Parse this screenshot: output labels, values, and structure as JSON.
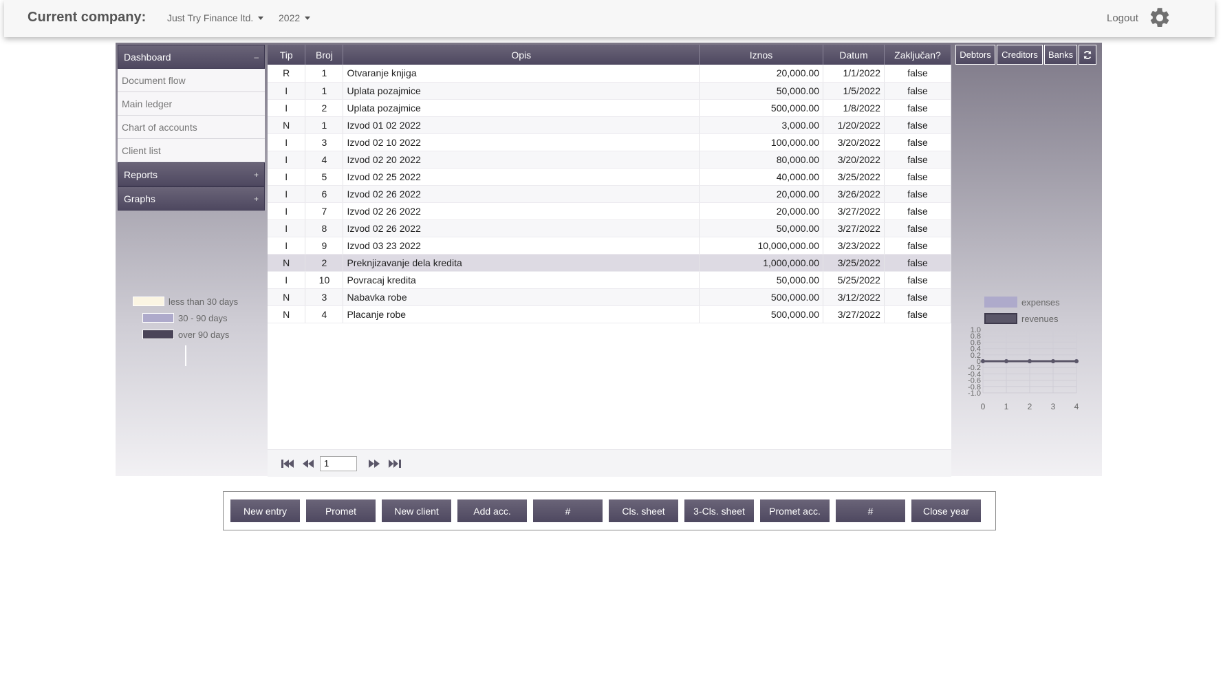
{
  "header": {
    "company_label": "Current company:",
    "company_value": "Just Try Finance ltd.",
    "year_value": "2022",
    "logout_label": "Logout"
  },
  "sidebar": {
    "dashboard": {
      "label": "Dashboard",
      "sign": "–"
    },
    "items": [
      {
        "label": "Document flow"
      },
      {
        "label": "Main ledger"
      },
      {
        "label": "Chart of accounts"
      },
      {
        "label": "Client list"
      }
    ],
    "reports": {
      "label": "Reports",
      "sign": "+"
    },
    "graphs": {
      "label": "Graphs",
      "sign": "+"
    }
  },
  "aging_legend": [
    {
      "label": "less than 30 days",
      "color": "#fbf5e3"
    },
    {
      "label": "30 - 90 days",
      "color": "#aeaacb"
    },
    {
      "label": "over 90 days",
      "color": "#4a4458"
    }
  ],
  "table": {
    "columns": [
      "Tip",
      "Broj",
      "Opis",
      "Iznos",
      "Datum",
      "Zaključan?"
    ],
    "rows": [
      {
        "tip": "R",
        "broj": "1",
        "opis": "Otvaranje knjiga",
        "iznos": "20,000.00",
        "datum": "1/1/2022",
        "locked": "false"
      },
      {
        "tip": "I",
        "broj": "1",
        "opis": "Uplata pozajmice",
        "iznos": "50,000.00",
        "datum": "1/5/2022",
        "locked": "false"
      },
      {
        "tip": "I",
        "broj": "2",
        "opis": "Uplata pozajmice",
        "iznos": "500,000.00",
        "datum": "1/8/2022",
        "locked": "false"
      },
      {
        "tip": "N",
        "broj": "1",
        "opis": "Izvod 01 02 2022",
        "iznos": "3,000.00",
        "datum": "1/20/2022",
        "locked": "false"
      },
      {
        "tip": "I",
        "broj": "3",
        "opis": "Izvod 02 10 2022",
        "iznos": "100,000.00",
        "datum": "3/20/2022",
        "locked": "false"
      },
      {
        "tip": "I",
        "broj": "4",
        "opis": "Izvod 02 20 2022",
        "iznos": "80,000.00",
        "datum": "3/20/2022",
        "locked": "false"
      },
      {
        "tip": "I",
        "broj": "5",
        "opis": "Izvod 02 25 2022",
        "iznos": "40,000.00",
        "datum": "3/25/2022",
        "locked": "false"
      },
      {
        "tip": "I",
        "broj": "6",
        "opis": "Izvod 02 26 2022",
        "iznos": "20,000.00",
        "datum": "3/26/2022",
        "locked": "false"
      },
      {
        "tip": "I",
        "broj": "7",
        "opis": "Izvod 02 26 2022",
        "iznos": "20,000.00",
        "datum": "3/27/2022",
        "locked": "false"
      },
      {
        "tip": "I",
        "broj": "8",
        "opis": "Izvod 02 26 2022",
        "iznos": "50,000.00",
        "datum": "3/27/2022",
        "locked": "false"
      },
      {
        "tip": "I",
        "broj": "9",
        "opis": "Izvod 03 23 2022",
        "iznos": "10,000,000.00",
        "datum": "3/23/2022",
        "locked": "false"
      },
      {
        "tip": "N",
        "broj": "2",
        "opis": "Preknjizavanje dela kredita",
        "iznos": "1,000,000.00",
        "datum": "3/25/2022",
        "locked": "false",
        "selected": true
      },
      {
        "tip": "I",
        "broj": "10",
        "opis": "Povracaj kredita",
        "iznos": "50,000.00",
        "datum": "5/25/2022",
        "locked": "false"
      },
      {
        "tip": "N",
        "broj": "3",
        "opis": "Nabavka robe",
        "iznos": "500,000.00",
        "datum": "3/12/2022",
        "locked": "false"
      },
      {
        "tip": "N",
        "broj": "4",
        "opis": "Placanje robe",
        "iznos": "500,000.00",
        "datum": "3/27/2022",
        "locked": "false"
      }
    ]
  },
  "pager": {
    "page": "1",
    "icons": [
      "first-page-icon",
      "prev-page-icon",
      "next-page-icon",
      "last-page-icon"
    ]
  },
  "right_panel": {
    "tabs": [
      "Debtors",
      "Creditors",
      "Banks"
    ],
    "refresh_icon": "refresh-icon",
    "legend": [
      {
        "label": "expenses",
        "color": "#aeaacb"
      },
      {
        "label": "revenues",
        "color": "#5a5668"
      }
    ]
  },
  "chart_data": {
    "type": "line",
    "x": [
      0,
      1,
      2,
      3,
      4
    ],
    "series": [
      {
        "name": "expenses",
        "values": [
          0,
          0,
          0,
          0,
          0
        ],
        "color": "#aeaacb"
      },
      {
        "name": "revenues",
        "values": [
          0,
          0,
          0,
          0,
          0
        ],
        "color": "#5a5668"
      }
    ],
    "xticks": [
      "0",
      "1",
      "2",
      "3",
      "4"
    ],
    "yticks": [
      "1.0",
      "0.8",
      "0.6",
      "0.4",
      "0.2",
      "0",
      "-0.2",
      "-0.4",
      "-0.6",
      "-0.8",
      "-1.0"
    ],
    "ylim": [
      -1.0,
      1.0
    ],
    "xlim": [
      0,
      4
    ],
    "grid": true,
    "legend": "top"
  },
  "toolbar": {
    "buttons": [
      "New entry",
      "Promet",
      "New client",
      "Add acc.",
      "#",
      "Cls. sheet",
      "3-Cls. sheet",
      "Promet acc.",
      "#",
      "Close year"
    ]
  }
}
